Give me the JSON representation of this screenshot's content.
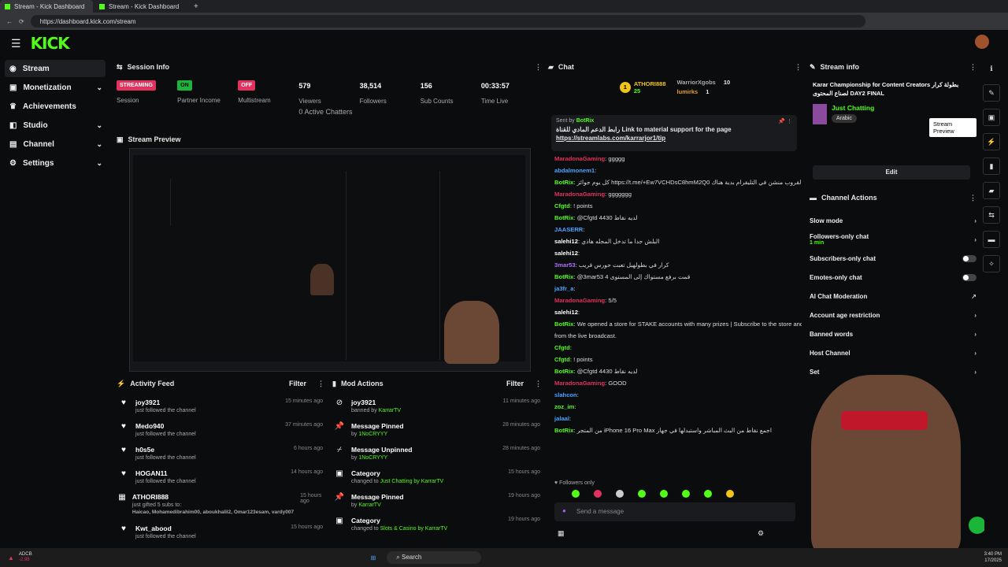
{
  "browser": {
    "tabs": [
      "Stream - Kick Dashboard",
      "Stream - Kick Dashboard"
    ],
    "url": "https://dashboard.kick.com/stream"
  },
  "logo": "KICK",
  "sidebar": {
    "items": [
      {
        "label": "Stream"
      },
      {
        "label": "Monetization"
      },
      {
        "label": "Achievements"
      },
      {
        "label": "Studio"
      },
      {
        "label": "Channel"
      },
      {
        "label": "Settings"
      }
    ]
  },
  "session_info": {
    "title": "Session Info",
    "stats": [
      {
        "badge": "STREAMING",
        "label": "Session"
      },
      {
        "badge": "ON",
        "label": "Partner Income"
      },
      {
        "badge": "OFF",
        "label": "Multistream"
      },
      {
        "value": "579",
        "label": "Viewers",
        "extra": "0",
        "extra_label": "Active Chatters"
      },
      {
        "value": "38,514",
        "label": "Followers"
      },
      {
        "value": "156",
        "label": "Sub Counts"
      },
      {
        "value": "00:33:57",
        "label": "Time Live"
      }
    ]
  },
  "preview": {
    "title": "Stream Preview"
  },
  "activity": {
    "title": "Activity Feed",
    "filter": "Filter",
    "rows": [
      {
        "name": "joy3921",
        "sub": "just followed the channel",
        "time": "15 minutes ago"
      },
      {
        "name": "Medo940",
        "sub": "just followed the channel",
        "time": "37 minutes ago"
      },
      {
        "name": "h0s5e",
        "sub": "just followed the channel",
        "time": "6 hours ago"
      },
      {
        "name": "HOGAN11",
        "sub": "just followed the channel",
        "time": "14 hours ago"
      },
      {
        "name": "ATHORI888",
        "sub": "just gifted 5 subs to:",
        "sub2": "Haicao, Mohamedibrahim00, aboukhalil2, Omar123esam, vardy007",
        "time": "15 hours ago"
      },
      {
        "name": "Kwt_abood",
        "sub": "just followed the channel",
        "time": "15 hours ago"
      }
    ]
  },
  "mod": {
    "title": "Mod Actions",
    "filter": "Filter",
    "rows": [
      {
        "name": "joy3921",
        "sub": "banned by",
        "by": "KarrarTV",
        "time": "11 minutes ago"
      },
      {
        "name": "Message Pinned",
        "sub": "by",
        "by": "1NoCRYYY",
        "time": "28 minutes ago"
      },
      {
        "name": "Message Unpinned",
        "sub": "by",
        "by": "1NoCRYYY",
        "time": "28 minutes ago"
      },
      {
        "name": "Category",
        "sub": "changed to",
        "by": "Just Chatting by KarrarTV",
        "time": "15 hours ago"
      },
      {
        "name": "Message Pinned",
        "sub": "by",
        "by": "KarrarTV",
        "time": "19 hours ago"
      },
      {
        "name": "Category",
        "sub": "changed to",
        "by": "Slots & Casino by KarrarTV",
        "time": "19 hours ago"
      }
    ]
  },
  "chat": {
    "title": "Chat",
    "top": [
      {
        "name": "ATHORI888",
        "count": "25"
      },
      {
        "name": "WarriorXgobs",
        "count": "10"
      },
      {
        "name": "lumirks",
        "count": "1"
      }
    ],
    "pinned": {
      "sent_by": "Sent by",
      "user": "BotRix",
      "text": "رابط الدعم المادي للقناة Link to material support for the page",
      "link": "https://streamlabs.com/karrarjor1/tip"
    },
    "messages": [
      {
        "u": "MaradonaGaming",
        "c": "red",
        "t": "ggggg"
      },
      {
        "u": "abdalmonem1",
        "c": "blue",
        "t": ""
      },
      {
        "u": "BotRix",
        "c": "lg",
        "t": "كل يوم جوائز https://t.me/+Ew7VCHDsC8hmM2Q0 الإنضمام لقروب منشن في التليقرام بدية هناك"
      },
      {
        "u": "MaradonaGaming",
        "c": "red",
        "t": "ggggggg"
      },
      {
        "u": "Cfgtd",
        "c": "lg",
        "t": "! points"
      },
      {
        "u": "BotRix",
        "c": "lg",
        "t": "@Cfgtd 4430 لديه نقاط"
      },
      {
        "u": "JAASERR",
        "c": "blue",
        "t": ""
      },
      {
        "u": "salehi12",
        "c": "w",
        "t": "البلش جدا ما تدخل المجله هاذي"
      },
      {
        "u": "salehi12",
        "c": "w",
        "t": ""
      },
      {
        "u": "3mar53",
        "c": "pur",
        "t": "كرار في بطولهبل تعبت حورس قريب"
      },
      {
        "u": "BotRix",
        "c": "lg",
        "t": "@3mar53 قمت برفع مستواك إلى المستوى 4"
      },
      {
        "u": "ja3fr_a",
        "c": "blue",
        "t": ""
      },
      {
        "u": "MaradonaGaming",
        "c": "red",
        "t": "5/5"
      },
      {
        "u": "salehi12",
        "c": "w",
        "t": ""
      },
      {
        "u": "BotRix",
        "c": "lg",
        "t": "We opened a store for STAKE accounts with many prizes | Subscribe to the store and collect points"
      },
      {
        "u": "",
        "c": "w",
        "t": "from the live broadcast."
      },
      {
        "u": "Cfgtd",
        "c": "lg",
        "t": ""
      },
      {
        "u": "Cfgtd",
        "c": "lg",
        "t": "! points"
      },
      {
        "u": "BotRix",
        "c": "lg",
        "t": "@Cfgtd 4430 لديه نقاط"
      },
      {
        "u": "MaradonaGaming",
        "c": "red",
        "t": "GOOD"
      },
      {
        "u": "slahcon",
        "c": "blue",
        "t": ""
      },
      {
        "u": "zoz_im",
        "c": "lg",
        "t": ""
      },
      {
        "u": "jalaal",
        "c": "blue",
        "t": ""
      },
      {
        "u": "BotRix",
        "c": "lg",
        "t": "من المتجر iPhone 16 Pro Max اجمع نقاط من البث المباشر واستبدلها في جهاز"
      }
    ],
    "followers_only": "Followers only",
    "send_placeholder": "Send a message"
  },
  "stream_info": {
    "title": "Stream info",
    "name": "Karar Championship for Content Creators بطولة كرار لصناع المحتوى DAY2 FINAL",
    "category": "Just Chatting",
    "tag": "Arabic",
    "edit": "Edit",
    "tooltip": "Stream Preview"
  },
  "channel_actions": {
    "title": "Channel Actions",
    "items": [
      {
        "label": "Slow mode",
        "kind": "arrow"
      },
      {
        "label": "Followers-only chat",
        "sub": "1 min",
        "kind": "arrow"
      },
      {
        "label": "Subscribers-only chat",
        "kind": "toggle"
      },
      {
        "label": "Emotes-only chat",
        "kind": "toggle"
      },
      {
        "label": "AI Chat Moderation",
        "kind": "ext"
      },
      {
        "label": "Account age restriction",
        "kind": "arrow"
      },
      {
        "label": "Banned words",
        "kind": "arrow"
      },
      {
        "label": "Host Channel",
        "kind": "arrow"
      },
      {
        "label": "Set",
        "kind": "arrow"
      }
    ]
  },
  "taskbar": {
    "ticker": "ADCB",
    "change": "-2.98",
    "search": "Search",
    "time": "3:40 PM",
    "date": "17/2025"
  }
}
